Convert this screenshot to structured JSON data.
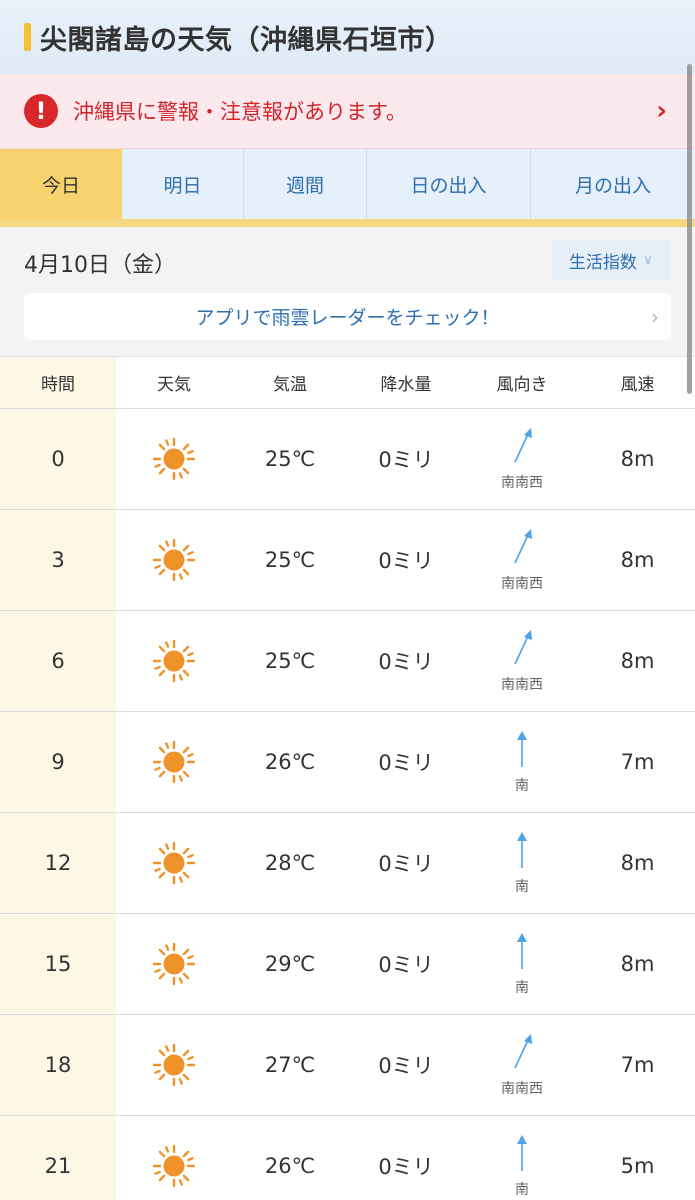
{
  "header": {
    "title": "尖閣諸島の天気（沖縄県石垣市）"
  },
  "alert": {
    "icon": "exclamation-icon",
    "symbol": "!",
    "text": "沖縄県に警報・注意報があります。",
    "chevron": "›"
  },
  "tabs": [
    {
      "label": "今日",
      "active": true
    },
    {
      "label": "明日",
      "active": false
    },
    {
      "label": "週間",
      "active": false
    },
    {
      "label": "日の出入",
      "active": false
    },
    {
      "label": "月の出入",
      "active": false
    }
  ],
  "date": {
    "text": "4月10日（金）"
  },
  "index_button": {
    "label": "生活指数",
    "chevron": "∨"
  },
  "radar_button": {
    "label": "アプリで雨雲レーダーをチェック！",
    "chevron": "›"
  },
  "table": {
    "headers": {
      "time": "時間",
      "weather": "天気",
      "temp": "気温",
      "rain": "降水量",
      "wind_dir": "風向き",
      "wind_speed": "風速"
    },
    "rows": [
      {
        "time": "0",
        "weather": "sunny-icon",
        "temp": "25℃",
        "rain": "0ミリ",
        "wind_dir": "南南西",
        "wind_speed": "8m"
      },
      {
        "time": "3",
        "weather": "sunny-icon",
        "temp": "25℃",
        "rain": "0ミリ",
        "wind_dir": "南南西",
        "wind_speed": "8m"
      },
      {
        "time": "6",
        "weather": "sunny-icon",
        "temp": "25℃",
        "rain": "0ミリ",
        "wind_dir": "南南西",
        "wind_speed": "8m"
      },
      {
        "time": "9",
        "weather": "sunny-icon",
        "temp": "26℃",
        "rain": "0ミリ",
        "wind_dir": "南",
        "wind_speed": "7m"
      },
      {
        "time": "12",
        "weather": "sunny-icon",
        "temp": "28℃",
        "rain": "0ミリ",
        "wind_dir": "南",
        "wind_speed": "8m"
      },
      {
        "time": "15",
        "weather": "sunny-icon",
        "temp": "29℃",
        "rain": "0ミリ",
        "wind_dir": "南",
        "wind_speed": "8m"
      },
      {
        "time": "18",
        "weather": "sunny-icon",
        "temp": "27℃",
        "rain": "0ミリ",
        "wind_dir": "南南西",
        "wind_speed": "7m"
      },
      {
        "time": "21",
        "weather": "sunny-icon",
        "temp": "26℃",
        "rain": "0ミリ",
        "wind_dir": "南",
        "wind_speed": "5m"
      }
    ]
  },
  "colors": {
    "accent": "#f6d36f",
    "link": "#2f6fb0",
    "alert": "#d1252b",
    "sun": "#f0922a",
    "arrow": "#4da3e6"
  }
}
